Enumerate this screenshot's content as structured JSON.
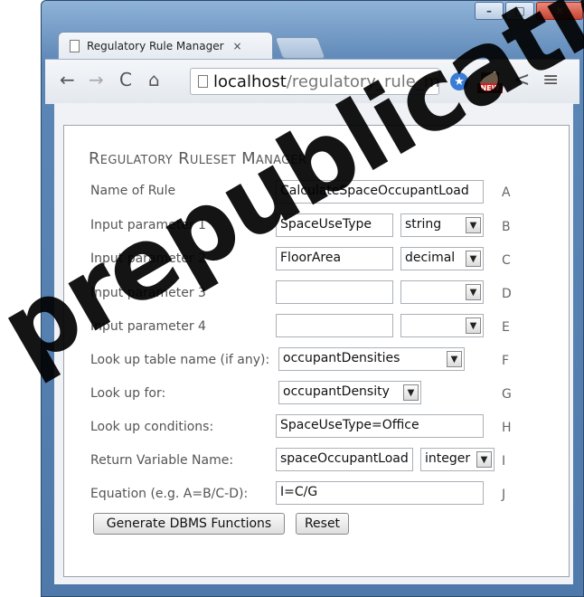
{
  "browser": {
    "tab_title": "Regulatory Rule Manager",
    "tab_close": "×",
    "url_host": "localhost",
    "url_path": "/regulatory_rule_ma",
    "ext_badge": "NEW"
  },
  "form": {
    "heading": "Regulatory Ruleset Manager",
    "rows": [
      {
        "label": "Name of Rule",
        "value": "CalculateSpaceOccupantLoad",
        "letter": "A"
      },
      {
        "label": "Input parameter 1",
        "value": "SpaceUseType",
        "type": "string",
        "letter": "B"
      },
      {
        "label": "Input parameter 2",
        "value": "FloorArea",
        "type": "decimal",
        "letter": "C"
      },
      {
        "label": "Input parameter 3",
        "value": "",
        "type": "",
        "letter": "D"
      },
      {
        "label": "Input parameter 4",
        "value": "",
        "type": "",
        "letter": "E"
      },
      {
        "label": "Look up table name (if any):",
        "value": "occupantDensities",
        "letter": "F"
      },
      {
        "label": "Look up for:",
        "value": "occupantDensity",
        "letter": "G"
      },
      {
        "label": "Look up conditions:",
        "value": "SpaceUseType=Office",
        "letter": "H"
      },
      {
        "label": "Return Variable Name:",
        "value": "spaceOccupantLoad",
        "type": "integer",
        "letter": "I"
      },
      {
        "label": "Equation (e.g. A=B/C-D):",
        "value": "I=C/G",
        "letter": "J"
      }
    ],
    "generate_button": "Generate DBMS Functions",
    "reset_button": "Reset"
  },
  "watermark": "prepublication"
}
